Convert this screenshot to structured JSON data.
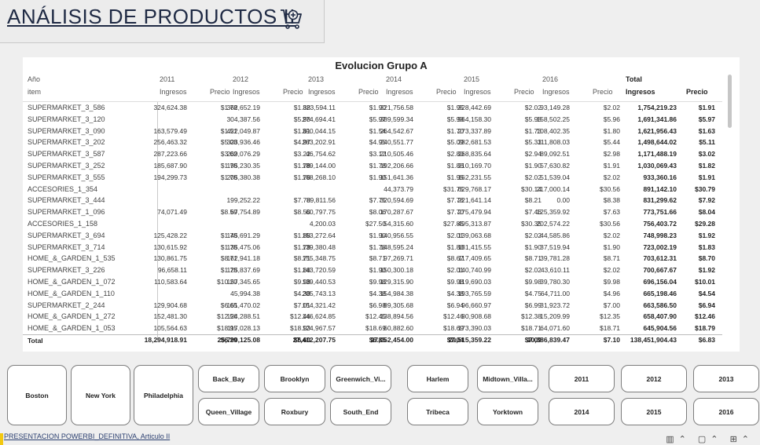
{
  "header": {
    "title": "ANÁLISIS DE PRODUCTOS II"
  },
  "table": {
    "title": "Evolucion Grupo A",
    "row_header_top": "Año",
    "row_header_bottom": "item",
    "years": [
      "2011",
      "2012",
      "2013",
      "2014",
      "2015",
      "2016"
    ],
    "total_label": "Total",
    "col_ingresos": "Ingresos",
    "col_precio": "Precio",
    "rows": [
      {
        "item": "SUPERMARKET_3_586",
        "vals": [
          [
            "324,624.38",
            "$1.78"
          ],
          [
            "362,652.19",
            "$1.88"
          ],
          [
            "323,594.11",
            "$1.90"
          ],
          [
            "321,756.58",
            "$1.95"
          ],
          [
            "328,442.69",
            "$2.02"
          ],
          [
            "93,149.28",
            "$2.02"
          ]
        ],
        "total": [
          "1,754,219.23",
          "$1.91"
        ]
      },
      {
        "item": "SUPERMARKET_3_120",
        "vals": [
          [
            "",
            ""
          ],
          [
            "304,387.56",
            "$5.98"
          ],
          [
            "274,694.41",
            "$5.97"
          ],
          [
            "389,599.34",
            "$5.98"
          ],
          [
            "564,158.30",
            "$5.98"
          ],
          [
            "158,502.25",
            "$5.96"
          ]
        ],
        "total": [
          "1,691,341.86",
          "$5.97"
        ]
      },
      {
        "item": "SUPERMARKET_3_090",
        "vals": [
          [
            "163,579.49",
            "$1.51"
          ],
          [
            "422,049.87",
            "$1.61"
          ],
          [
            "390,044.15",
            "$1.54"
          ],
          [
            "264,542.67",
            "$1.70"
          ],
          [
            "273,337.89",
            "$1.73"
          ],
          [
            "108,402.35",
            "$1.80"
          ]
        ],
        "total": [
          "1,621,956.43",
          "$1.63"
        ]
      },
      {
        "item": "SUPERMARKET_3_202",
        "vals": [
          [
            "256,463.32",
            "$5.08"
          ],
          [
            "323,936.46",
            "$4.97"
          ],
          [
            "283,202.91",
            "$4.95"
          ],
          [
            "240,551.77",
            "$5.09"
          ],
          [
            "282,681.53",
            "$5.33"
          ],
          [
            "111,808.03",
            "$5.44"
          ]
        ],
        "total": [
          "1,498,644.02",
          "$5.11"
        ]
      },
      {
        "item": "SUPERMARKET_3_587",
        "vals": [
          [
            "287,223.66",
            "$3.02"
          ],
          [
            "269,076.29",
            "$3.22"
          ],
          [
            "46,754.62",
            "$3.12"
          ],
          [
            "210,505.46",
            "$2.80"
          ],
          [
            "268,835.64",
            "$2.94"
          ],
          [
            "89,092.51",
            "$2.98"
          ]
        ],
        "total": [
          "1,171,488.19",
          "$3.02"
        ]
      },
      {
        "item": "SUPERMARKET_3_252",
        "vals": [
          [
            "185,687.90",
            "$1.78"
          ],
          [
            "195,230.35",
            "$1.78"
          ],
          [
            "189,144.00",
            "$1.78"
          ],
          [
            "192,206.66",
            "$1.86"
          ],
          [
            "210,169.70",
            "$1.90"
          ],
          [
            "57,630.82",
            "$1.91"
          ]
        ],
        "total": [
          "1,030,069.43",
          "$1.82"
        ]
      },
      {
        "item": "SUPERMARKET_3_555",
        "vals": [
          [
            "194,299.73",
            "$1.78"
          ],
          [
            "205,380.38",
            "$1.78"
          ],
          [
            "168,268.10",
            "$1.90"
          ],
          [
            "151,641.36",
            "$1.95"
          ],
          [
            "162,231.55",
            "$2.02"
          ],
          [
            "51,539.04",
            "$2.02"
          ]
        ],
        "total": [
          "933,360.16",
          "$1.91"
        ]
      },
      {
        "item": "ACCESORIES_1_354",
        "vals": [
          [
            "",
            ""
          ],
          [
            "",
            ""
          ],
          [
            "",
            ""
          ],
          [
            "44,373.79",
            "$31.75"
          ],
          [
            "629,768.17",
            "$30.14"
          ],
          [
            "217,000.14",
            "$30.56"
          ]
        ],
        "total": [
          "891,142.10",
          "$30.79"
        ]
      },
      {
        "item": "SUPERMARKET_3_444",
        "vals": [
          [
            "",
            ""
          ],
          [
            "199,252.22",
            "$7.78"
          ],
          [
            "89,811.56",
            "$7.75"
          ],
          [
            "320,594.69",
            "$7.76"
          ],
          [
            "221,641.14",
            "$8.21"
          ],
          [
            "0.00",
            "$8.38"
          ]
        ],
        "total": [
          "831,299.62",
          "$7.92"
        ]
      },
      {
        "item": "SUPERMARKET_1_096",
        "vals": [
          [
            "74,071.49",
            "$8.59"
          ],
          [
            "67,754.89",
            "$8.50"
          ],
          [
            "60,797.75",
            "$8.06"
          ],
          [
            "170,287.67",
            "$7.70"
          ],
          [
            "275,479.94",
            "$7.46"
          ],
          [
            "125,359.92",
            "$7.63"
          ]
        ],
        "total": [
          "773,751.66",
          "$8.04"
        ]
      },
      {
        "item": "ACCESORIES_1_158",
        "vals": [
          [
            "",
            ""
          ],
          [
            "",
            ""
          ],
          [
            "4,200.03",
            "$27.50"
          ],
          [
            "54,315.60",
            "$27.85"
          ],
          [
            "495,313.87",
            "$30.35"
          ],
          [
            "202,574.22",
            "$30.56"
          ]
        ],
        "total": [
          "756,403.72",
          "$29.28"
        ]
      },
      {
        "item": "SUPERMARKET_3_694",
        "vals": [
          [
            "125,428.22",
            "$1.78"
          ],
          [
            "145,691.29",
            "$1.88"
          ],
          [
            "153,272.64",
            "$1.90"
          ],
          [
            "140,956.55",
            "$2.01"
          ],
          [
            "139,063.68",
            "$2.02"
          ],
          [
            "44,585.86",
            "$2.02"
          ]
        ],
        "total": [
          "748,998.23",
          "$1.92"
        ]
      },
      {
        "item": "SUPERMARKET_3_714",
        "vals": [
          [
            "130,615.92",
            "$1.78"
          ],
          [
            "135,475.06",
            "$1.78"
          ],
          [
            "139,380.48",
            "$1.78"
          ],
          [
            "148,595.24",
            "$1.88"
          ],
          [
            "131,415.55",
            "$1.90"
          ],
          [
            "37,519.94",
            "$1.90"
          ]
        ],
        "total": [
          "723,002.19",
          "$1.83"
        ]
      },
      {
        "item": "HOME_&_GARDEN_1_535",
        "vals": [
          [
            "130,861.75",
            "$8.71"
          ],
          [
            "162,941.18",
            "$8.71"
          ],
          [
            "155,348.75",
            "$8.71"
          ],
          [
            "97,269.71",
            "$8.67"
          ],
          [
            "117,409.65",
            "$8.71"
          ],
          [
            "39,781.28",
            "$8.71"
          ]
        ],
        "total": [
          "703,612.31",
          "$8.70"
        ]
      },
      {
        "item": "SUPERMARKET_3_226",
        "vals": [
          [
            "96,658.11",
            "$1.78"
          ],
          [
            "125,837.69",
            "$1.88"
          ],
          [
            "143,720.59",
            "$1.90"
          ],
          [
            "150,300.18",
            "$2.01"
          ],
          [
            "140,740.99",
            "$2.02"
          ],
          [
            "43,610.11",
            "$2.02"
          ]
        ],
        "total": [
          "700,667.67",
          "$1.92"
        ]
      },
      {
        "item": "HOME_&_GARDEN_1_072",
        "vals": [
          [
            "110,583.64",
            "$10.20"
          ],
          [
            "157,345.65",
            "$9.98"
          ],
          [
            "139,440.53",
            "$9.98"
          ],
          [
            "129,315.90",
            "$9.98"
          ],
          [
            "119,690.03",
            "$9.98"
          ],
          [
            "39,780.30",
            "$9.98"
          ]
        ],
        "total": [
          "696,156.04",
          "$10.01"
        ]
      },
      {
        "item": "HOME_&_GARDEN_1_110",
        "vals": [
          [
            "",
            ""
          ],
          [
            "45,994.38",
            "$4.38"
          ],
          [
            "205,743.13",
            "$4.38"
          ],
          [
            "154,984.38",
            "$4.38"
          ],
          [
            "193,765.59",
            "$4.75"
          ],
          [
            "64,711.00",
            "$4.96"
          ]
        ],
        "total": [
          "665,198.46",
          "$4.54"
        ]
      },
      {
        "item": "SUPERMARKET_2_244",
        "vals": [
          [
            "129,904.68",
            "$6.65"
          ],
          [
            "161,470.02",
            "$7.01"
          ],
          [
            "154,321.42",
            "$6.98"
          ],
          [
            "89,305.68",
            "$6.94"
          ],
          [
            "96,660.97",
            "$6.99"
          ],
          [
            "31,923.72",
            "$7.00"
          ]
        ],
        "total": [
          "663,586.50",
          "$6.94"
        ]
      },
      {
        "item": "HOME_&_GARDEN_1_272",
        "vals": [
          [
            "152,481.30",
            "$12.56"
          ],
          [
            "124,288.51",
            "$12.46"
          ],
          [
            "146,624.85",
            "$12.45"
          ],
          [
            "138,894.56",
            "$12.46"
          ],
          [
            "80,908.68",
            "$12.38"
          ],
          [
            "15,209.99",
            "$12.35"
          ]
        ],
        "total": [
          "658,407.90",
          "$12.46"
        ]
      },
      {
        "item": "HOME_&_GARDEN_1_053",
        "vals": [
          [
            "105,564.63",
            "$18.95"
          ],
          [
            "117,028.13",
            "$18.93"
          ],
          [
            "124,967.57",
            "$18.69"
          ],
          [
            "60,882.60",
            "$18.69"
          ],
          [
            "173,390.03",
            "$18.71"
          ],
          [
            "64,071.60",
            "$18.71"
          ]
        ],
        "total": [
          "645,904.56",
          "$18.79"
        ]
      }
    ],
    "totals": {
      "label": "Total",
      "vals": [
        [
          "18,294,918.91",
          "$6.29"
        ],
        [
          "25,790,125.08",
          "$6.60"
        ],
        [
          "27,412,207.75",
          "$6.85"
        ],
        [
          "27,052,454.00",
          "$7.04"
        ],
        [
          "29,515,359.22",
          "$7.09"
        ],
        [
          "10,386,839.47",
          "$7.10"
        ]
      ],
      "total": [
        "138,451,904.43",
        "$6.83"
      ]
    }
  },
  "slicers": {
    "cities": [
      "Boston",
      "New York",
      "Philadelphia"
    ],
    "neighborhoods_top": [
      "Back_Bay",
      "Brooklyn",
      "Greenwich_Vi...",
      "Harlem",
      "Midtown_Villa..."
    ],
    "neighborhoods_bottom": [
      "Queen_Village",
      "Roxbury",
      "South_End",
      "Tribeca",
      "Yorktown"
    ],
    "years_top": [
      "2011",
      "2012",
      "2013"
    ],
    "years_bottom": [
      "2014",
      "2015",
      "2016"
    ]
  },
  "footer": {
    "file_name": "PRESENTACION POWERBI_DEFINITIVA, Articulo II"
  }
}
